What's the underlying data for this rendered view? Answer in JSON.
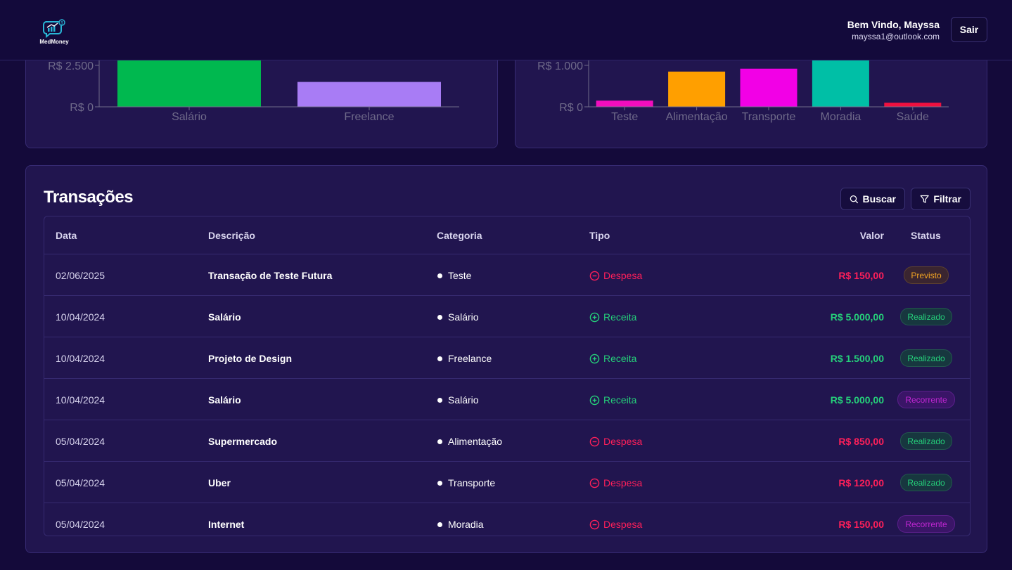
{
  "header": {
    "logo_text": "MedMoney",
    "greeting": "Bem Vindo, Mayssa",
    "email": "mayssa1@outlook.com",
    "logout_label": "Sair"
  },
  "chart_data": [
    {
      "type": "bar",
      "title": "",
      "categories": [
        "Salário",
        "Freelance"
      ],
      "values": [
        5000,
        1500
      ],
      "colors": [
        "#00b84f",
        "#a87cf5"
      ],
      "ytick_labels": [
        "R$ 0",
        "R$ 2.500"
      ],
      "yticks": [
        0,
        2500
      ],
      "ylim": [
        0,
        2800
      ],
      "grid": false
    },
    {
      "type": "bar",
      "title": "",
      "categories": [
        "Teste",
        "Alimentação",
        "Transporte",
        "Moradia",
        "Saúde"
      ],
      "values": [
        150,
        850,
        920,
        1150,
        100
      ],
      "colors": [
        "#f20dbd",
        "#ff9f00",
        "#f200e6",
        "#00bfa6",
        "#f0103f"
      ],
      "ytick_labels": [
        "R$ 0",
        "R$ 1.000"
      ],
      "yticks": [
        0,
        1000
      ],
      "ylim": [
        0,
        1120
      ],
      "grid": false
    }
  ],
  "transactions": {
    "title": "Transações",
    "search_label": "Buscar",
    "filter_label": "Filtrar",
    "columns": {
      "date": "Data",
      "description": "Descrição",
      "category": "Categoria",
      "type": "Tipo",
      "value": "Valor",
      "status": "Status"
    },
    "rows": [
      {
        "date": "02/06/2025",
        "description": "Transação de Teste Futura",
        "category": "Teste",
        "type": "Despesa",
        "value": "R$ 150,00",
        "status": "Previsto"
      },
      {
        "date": "10/04/2024",
        "description": "Salário",
        "category": "Salário",
        "type": "Receita",
        "value": "R$ 5.000,00",
        "status": "Realizado"
      },
      {
        "date": "10/04/2024",
        "description": "Projeto de Design",
        "category": "Freelance",
        "type": "Receita",
        "value": "R$ 1.500,00",
        "status": "Realizado"
      },
      {
        "date": "10/04/2024",
        "description": "Salário",
        "category": "Salário",
        "type": "Receita",
        "value": "R$ 5.000,00",
        "status": "Recorrente"
      },
      {
        "date": "05/04/2024",
        "description": "Supermercado",
        "category": "Alimentação",
        "type": "Despesa",
        "value": "R$ 850,00",
        "status": "Realizado"
      },
      {
        "date": "05/04/2024",
        "description": "Uber",
        "category": "Transporte",
        "type": "Despesa",
        "value": "R$ 120,00",
        "status": "Realizado"
      },
      {
        "date": "05/04/2024",
        "description": "Internet",
        "category": "Moradia",
        "type": "Despesa",
        "value": "R$ 150,00",
        "status": "Recorrente"
      }
    ]
  }
}
